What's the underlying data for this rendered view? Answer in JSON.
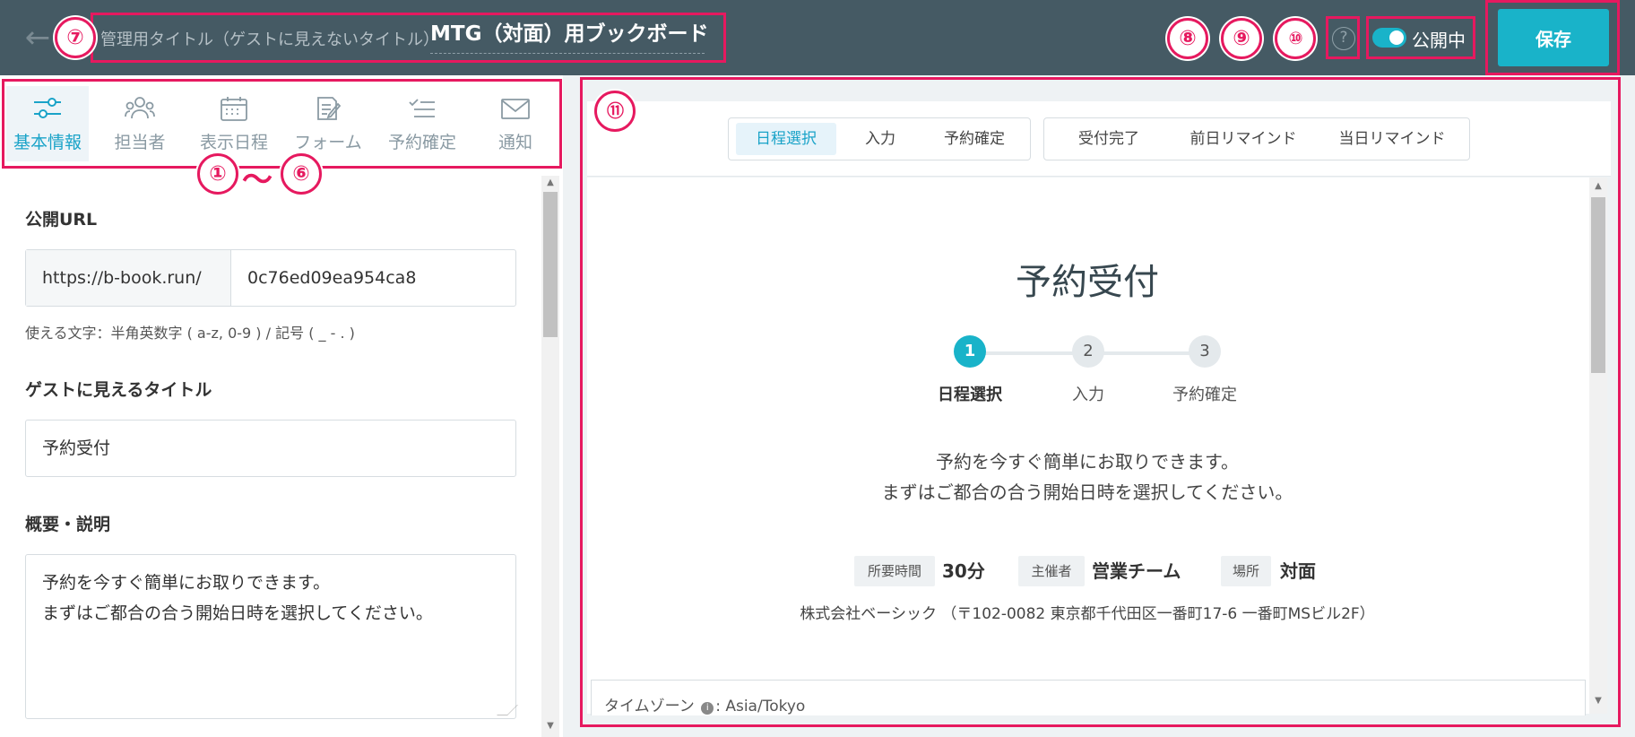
{
  "header": {
    "admin_label": "管理用タイトル（ゲストに見えないタイトル）",
    "admin_title": "MTG（対面）用ブックボード",
    "help_symbol": "?",
    "publish_label": "公開中",
    "publish_on": true,
    "save_label": "保存",
    "back_symbol": "←"
  },
  "badges": {
    "b1": "①",
    "b6": "⑥",
    "range_sep": "～",
    "b7": "⑦",
    "b8": "⑧",
    "b9": "⑨",
    "b10": "⑩",
    "b11": "⑪"
  },
  "tabs": [
    {
      "label": "基本情報",
      "icon": "sliders-icon",
      "active": true
    },
    {
      "label": "担当者",
      "icon": "people-icon",
      "active": false
    },
    {
      "label": "表示日程",
      "icon": "calendar-icon",
      "active": false
    },
    {
      "label": "フォーム",
      "icon": "form-edit-icon",
      "active": false
    },
    {
      "label": "予約確定",
      "icon": "checklist-icon",
      "active": false
    },
    {
      "label": "通知",
      "icon": "envelope-icon",
      "active": false
    }
  ],
  "form": {
    "url_label": "公開URL",
    "url_prefix": "https://b-book.run/",
    "url_slug": "0c76ed09ea954ca8",
    "url_hint": "使える文字：半角英数字 ( a-z, 0-9 ) / 記号 ( _ - . )",
    "title_label": "ゲストに見えるタイトル",
    "title_value": "予約受付",
    "desc_label": "概要・説明",
    "desc_value": "予約を今すぐ簡単にお取りできます。\nまずはご都合の合う開始日時を選択してください。"
  },
  "preview": {
    "seg1": [
      "日程選択",
      "入力",
      "予約確定"
    ],
    "seg2": [
      "受付完了",
      "前日リマインド",
      "当日リマインド"
    ],
    "page_title": "予約受付",
    "steps": [
      {
        "num": "1",
        "label": "日程選択"
      },
      {
        "num": "2",
        "label": "入力"
      },
      {
        "num": "3",
        "label": "予約確定"
      }
    ],
    "description": "予約を今すぐ簡単にお取りできます。\nまずはご都合の合う開始日時を選択してください。",
    "meta": {
      "duration_tag": "所要時間",
      "duration_val": "30分",
      "host_tag": "主催者",
      "host_val": "営業チーム",
      "place_tag": "場所",
      "place_val": "対面"
    },
    "address": "株式会社ベーシック （〒102-0082 東京都千代田区一番町17-6 一番町MSビル2F）",
    "tz_label": "タイムゾーン",
    "tz_value": ": Asia/Tokyo"
  },
  "colors": {
    "topbar": "#455a64",
    "accent": "#19b3c9",
    "highlight": "#e6195f"
  }
}
